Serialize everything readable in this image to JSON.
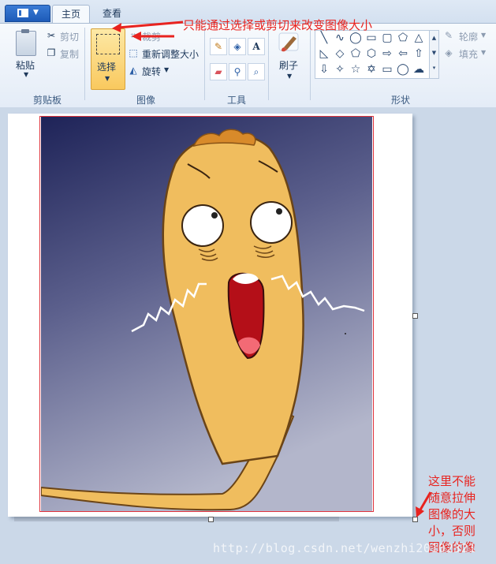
{
  "tabs": {
    "home": "主页",
    "view": "查看"
  },
  "clipboard": {
    "paste": "粘贴",
    "cut": "剪切",
    "copy": "复制",
    "group": "剪贴板"
  },
  "image": {
    "select": "选择",
    "crop": "裁剪",
    "resize": "重新调整大小",
    "rotate": "旋转",
    "group": "图像"
  },
  "tools": {
    "group": "工具",
    "pencil": "pencil-icon",
    "fill": "fill-icon",
    "text_glyph": "A",
    "eraser": "eraser-icon",
    "picker": "color-picker-icon",
    "magnifier": "magnifier-icon"
  },
  "brush": {
    "label": "刷子"
  },
  "shapes": {
    "group": "形状",
    "outline": "轮廓",
    "fill": "填充"
  },
  "annotations": {
    "top": "只能通过选择或剪切来改变图像大小",
    "side": [
      "这里不能",
      "随意拉伸",
      "图像的大",
      "小，否则",
      "图像的像"
    ]
  },
  "watermark": "http://blog.csdn.net/wenzhi20102321",
  "colors": {
    "annotation": "#e8231f",
    "selected_button": "#f9c95e",
    "ribbon": "#f7fafd"
  }
}
